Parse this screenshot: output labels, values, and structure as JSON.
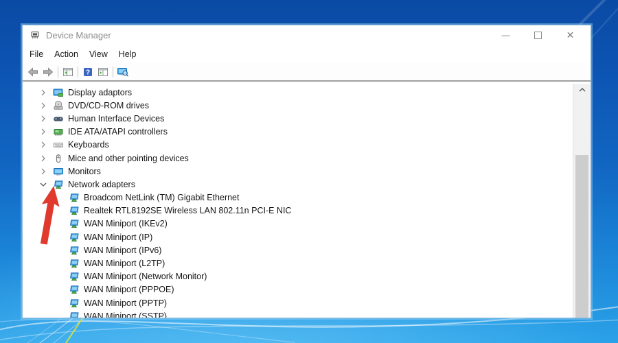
{
  "window": {
    "title": "Device Manager",
    "controls": {
      "minimize": "—",
      "maximize": "□",
      "close": "✕"
    }
  },
  "menubar": {
    "items": [
      "File",
      "Action",
      "View",
      "Help"
    ]
  },
  "toolbar": {
    "buttons": [
      {
        "name": "back",
        "icon": "back-arrow-icon"
      },
      {
        "name": "forward",
        "icon": "forward-arrow-icon"
      },
      {
        "name": "console-tree",
        "icon": "console-tree-icon"
      },
      {
        "name": "help",
        "icon": "help-icon"
      },
      {
        "name": "properties",
        "icon": "properties-icon"
      },
      {
        "name": "scan-hardware-changes",
        "icon": "scan-hardware-icon"
      }
    ]
  },
  "tree": {
    "items": [
      {
        "label": "Display adaptors",
        "icon": "display-adapter",
        "expanded": false
      },
      {
        "label": "DVD/CD-ROM drives",
        "icon": "dvd-drive",
        "expanded": false
      },
      {
        "label": "Human Interface Devices",
        "icon": "hid-device",
        "expanded": false
      },
      {
        "label": "IDE ATA/ATAPI controllers",
        "icon": "ide-controller",
        "expanded": false
      },
      {
        "label": "Keyboards",
        "icon": "keyboard",
        "expanded": false
      },
      {
        "label": "Mice and other pointing devices",
        "icon": "mouse",
        "expanded": false
      },
      {
        "label": "Monitors",
        "icon": "monitor",
        "expanded": false
      },
      {
        "label": "Network adapters",
        "icon": "network-adapter",
        "expanded": true,
        "children": [
          {
            "label": "Broadcom NetLink (TM) Gigabit Ethernet",
            "icon": "network-adapter"
          },
          {
            "label": "Realtek RTL8192SE Wireless LAN 802.11n PCI-E NIC",
            "icon": "network-adapter"
          },
          {
            "label": "WAN Miniport (IKEv2)",
            "icon": "network-adapter"
          },
          {
            "label": "WAN Miniport (IP)",
            "icon": "network-adapter"
          },
          {
            "label": "WAN Miniport (IPv6)",
            "icon": "network-adapter"
          },
          {
            "label": "WAN Miniport (L2TP)",
            "icon": "network-adapter"
          },
          {
            "label": "WAN Miniport (Network Monitor)",
            "icon": "network-adapter"
          },
          {
            "label": "WAN Miniport (PPPOE)",
            "icon": "network-adapter"
          },
          {
            "label": "WAN Miniport (PPTP)",
            "icon": "network-adapter"
          },
          {
            "label": "WAN Miniport (SSTP)",
            "icon": "network-adapter"
          }
        ]
      }
    ]
  },
  "annotation": {
    "arrow_color": "#e0392d"
  },
  "colors": {
    "desktop_top": "#0a4aa4",
    "desktop_bottom": "#2aa2e8",
    "window_bg": "#ffffff",
    "title_text": "#8a8a8a",
    "toolbar_divider": "#a0a0a0",
    "scrollbar_thumb": "#cdcdcd"
  }
}
